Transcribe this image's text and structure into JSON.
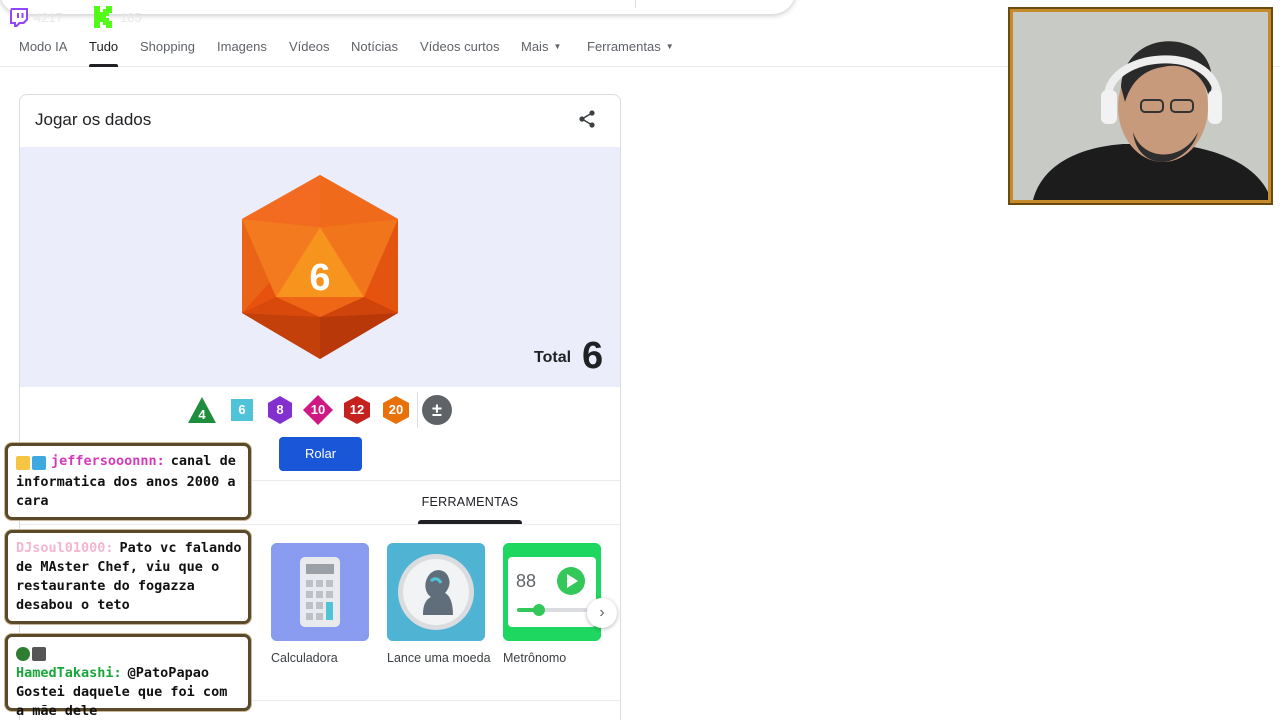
{
  "topbar": {
    "twitch_icon": "twitch-icon",
    "twitch_viewers": "4217",
    "kick_icon": "kick-icon",
    "kick_viewers": "185"
  },
  "nav": {
    "tabs": [
      {
        "label": "Modo IA"
      },
      {
        "label": "Tudo",
        "active": true
      },
      {
        "label": "Shopping"
      },
      {
        "label": "Imagens"
      },
      {
        "label": "Vídeos"
      },
      {
        "label": "Notícias"
      },
      {
        "label": "Vídeos curtos"
      },
      {
        "label": "Mais",
        "dropdown": true
      },
      {
        "label": "Ferramentas",
        "dropdown": true
      }
    ]
  },
  "dice_card": {
    "title": "Jogar os dados",
    "share_icon": "share-icon",
    "die_value": "6",
    "total_label": "Total",
    "total_value": "6",
    "dice_options": [
      {
        "label": "4",
        "color": "#1e8e3e",
        "shape": "triangle"
      },
      {
        "label": "6",
        "color": "#4fc3d8",
        "shape": "square"
      },
      {
        "label": "8",
        "color": "#8430ce",
        "shape": "octagon"
      },
      {
        "label": "10",
        "color": "#d01884",
        "shape": "diamond"
      },
      {
        "label": "12",
        "color": "#c5221f",
        "shape": "hexagon"
      },
      {
        "label": "20",
        "color": "#e8710a",
        "shape": "hexagon"
      },
      {
        "label": "±",
        "color": "#5f6368",
        "shape": "circle"
      }
    ],
    "roll_button": "Rolar",
    "tools_tab": "FERRAMENTAS",
    "tools": [
      {
        "label": "Calculadora",
        "icon": "calculator-icon",
        "color": "#8ab4f8"
      },
      {
        "label": "Lance uma moeda",
        "icon": "coin-icon",
        "color": "#4db6d9"
      },
      {
        "label": "Metrônomo",
        "icon": "metronome-icon",
        "color": "#1ed760",
        "readout": "88"
      }
    ],
    "next_icon": "chevron-right-icon"
  },
  "chat": [
    {
      "user": "jeffersooonnn:",
      "user_color": "#d63ab8",
      "message": "canal de informatica dos anos 2000 a cara"
    },
    {
      "user": "DJsoul01000:",
      "user_color": "#f2b6cf",
      "message": "Pato vc falando de MAster Chef, viu que o restaurante do fogazza desabou o teto"
    },
    {
      "user": "HamedTakashi:",
      "user_color": "#18a63a",
      "message": "@PatoPapao Gostei daquele que foi com a mãe dele"
    }
  ]
}
